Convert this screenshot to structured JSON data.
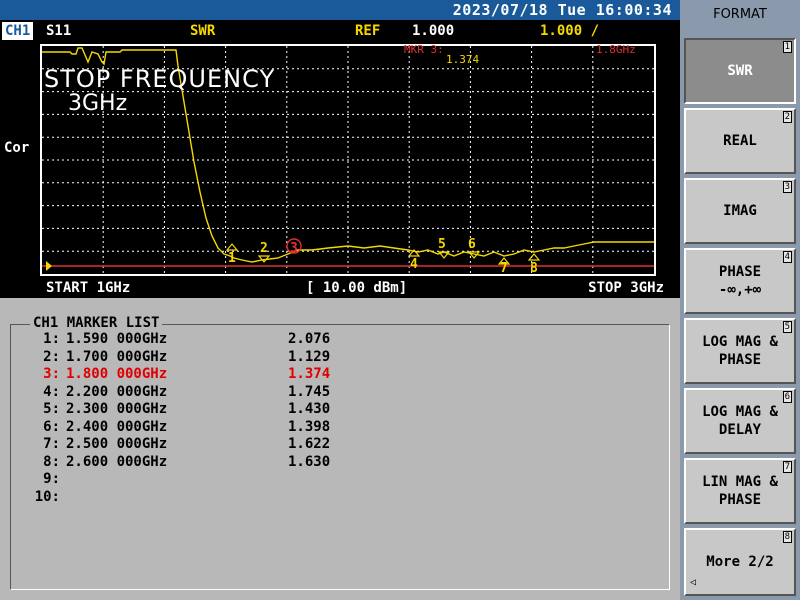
{
  "status_bar": {
    "datetime": "2023/07/18 Tue 16:00:34"
  },
  "channel": {
    "name": "CH1",
    "parameter": "S11",
    "format": "SWR",
    "ref_label": "REF",
    "ref_value": "1.000",
    "scale": "1.000 /"
  },
  "side_label": "Cor",
  "overlay": {
    "title": "STOP FREQUENCY",
    "value": "3GHz"
  },
  "marker_readout": {
    "label": "MKR 3:",
    "value": "1.374",
    "freq": "1.8GHz"
  },
  "freq_bar": {
    "start": "START 1GHz",
    "power": "[ 10.00 dBm]",
    "stop": "STOP 3GHz"
  },
  "marker_list": {
    "title": "CH1 MARKER LIST",
    "rows": [
      {
        "idx": "1:",
        "freq": "1.590 000GHz",
        "value": "2.076"
      },
      {
        "idx": "2:",
        "freq": "1.700 000GHz",
        "value": "1.129"
      },
      {
        "idx": "3:",
        "freq": "1.800 000GHz",
        "value": "1.374"
      },
      {
        "idx": "4:",
        "freq": "2.200 000GHz",
        "value": "1.745"
      },
      {
        "idx": "5:",
        "freq": "2.300 000GHz",
        "value": "1.430"
      },
      {
        "idx": "6:",
        "freq": "2.400 000GHz",
        "value": "1.398"
      },
      {
        "idx": "7:",
        "freq": "2.500 000GHz",
        "value": "1.622"
      },
      {
        "idx": "8:",
        "freq": "2.600 000GHz",
        "value": "1.630"
      },
      {
        "idx": "9:",
        "freq": "",
        "value": ""
      },
      {
        "idx": "10:",
        "freq": "",
        "value": ""
      }
    ]
  },
  "trace_markers": [
    "1",
    "2",
    "3",
    "4",
    "5",
    "6",
    "7",
    "8"
  ],
  "softkeys": {
    "header": "FORMAT",
    "keys": [
      {
        "label": "SWR",
        "num": "1"
      },
      {
        "label": "REAL",
        "num": "2"
      },
      {
        "label": "IMAG",
        "num": "3"
      },
      {
        "label": "PHASE\n-∞,+∞",
        "num": "4"
      },
      {
        "label": "LOG MAG &\nPHASE",
        "num": "5"
      },
      {
        "label": "LOG MAG &\nDELAY",
        "num": "6"
      },
      {
        "label": "LIN MAG &\nPHASE",
        "num": "7"
      },
      {
        "label": "More 2/2",
        "num": "8"
      }
    ]
  },
  "colors": {
    "trace": "#f5d800",
    "active_marker": "#e03030",
    "status_bar": "#1a5a9a"
  }
}
